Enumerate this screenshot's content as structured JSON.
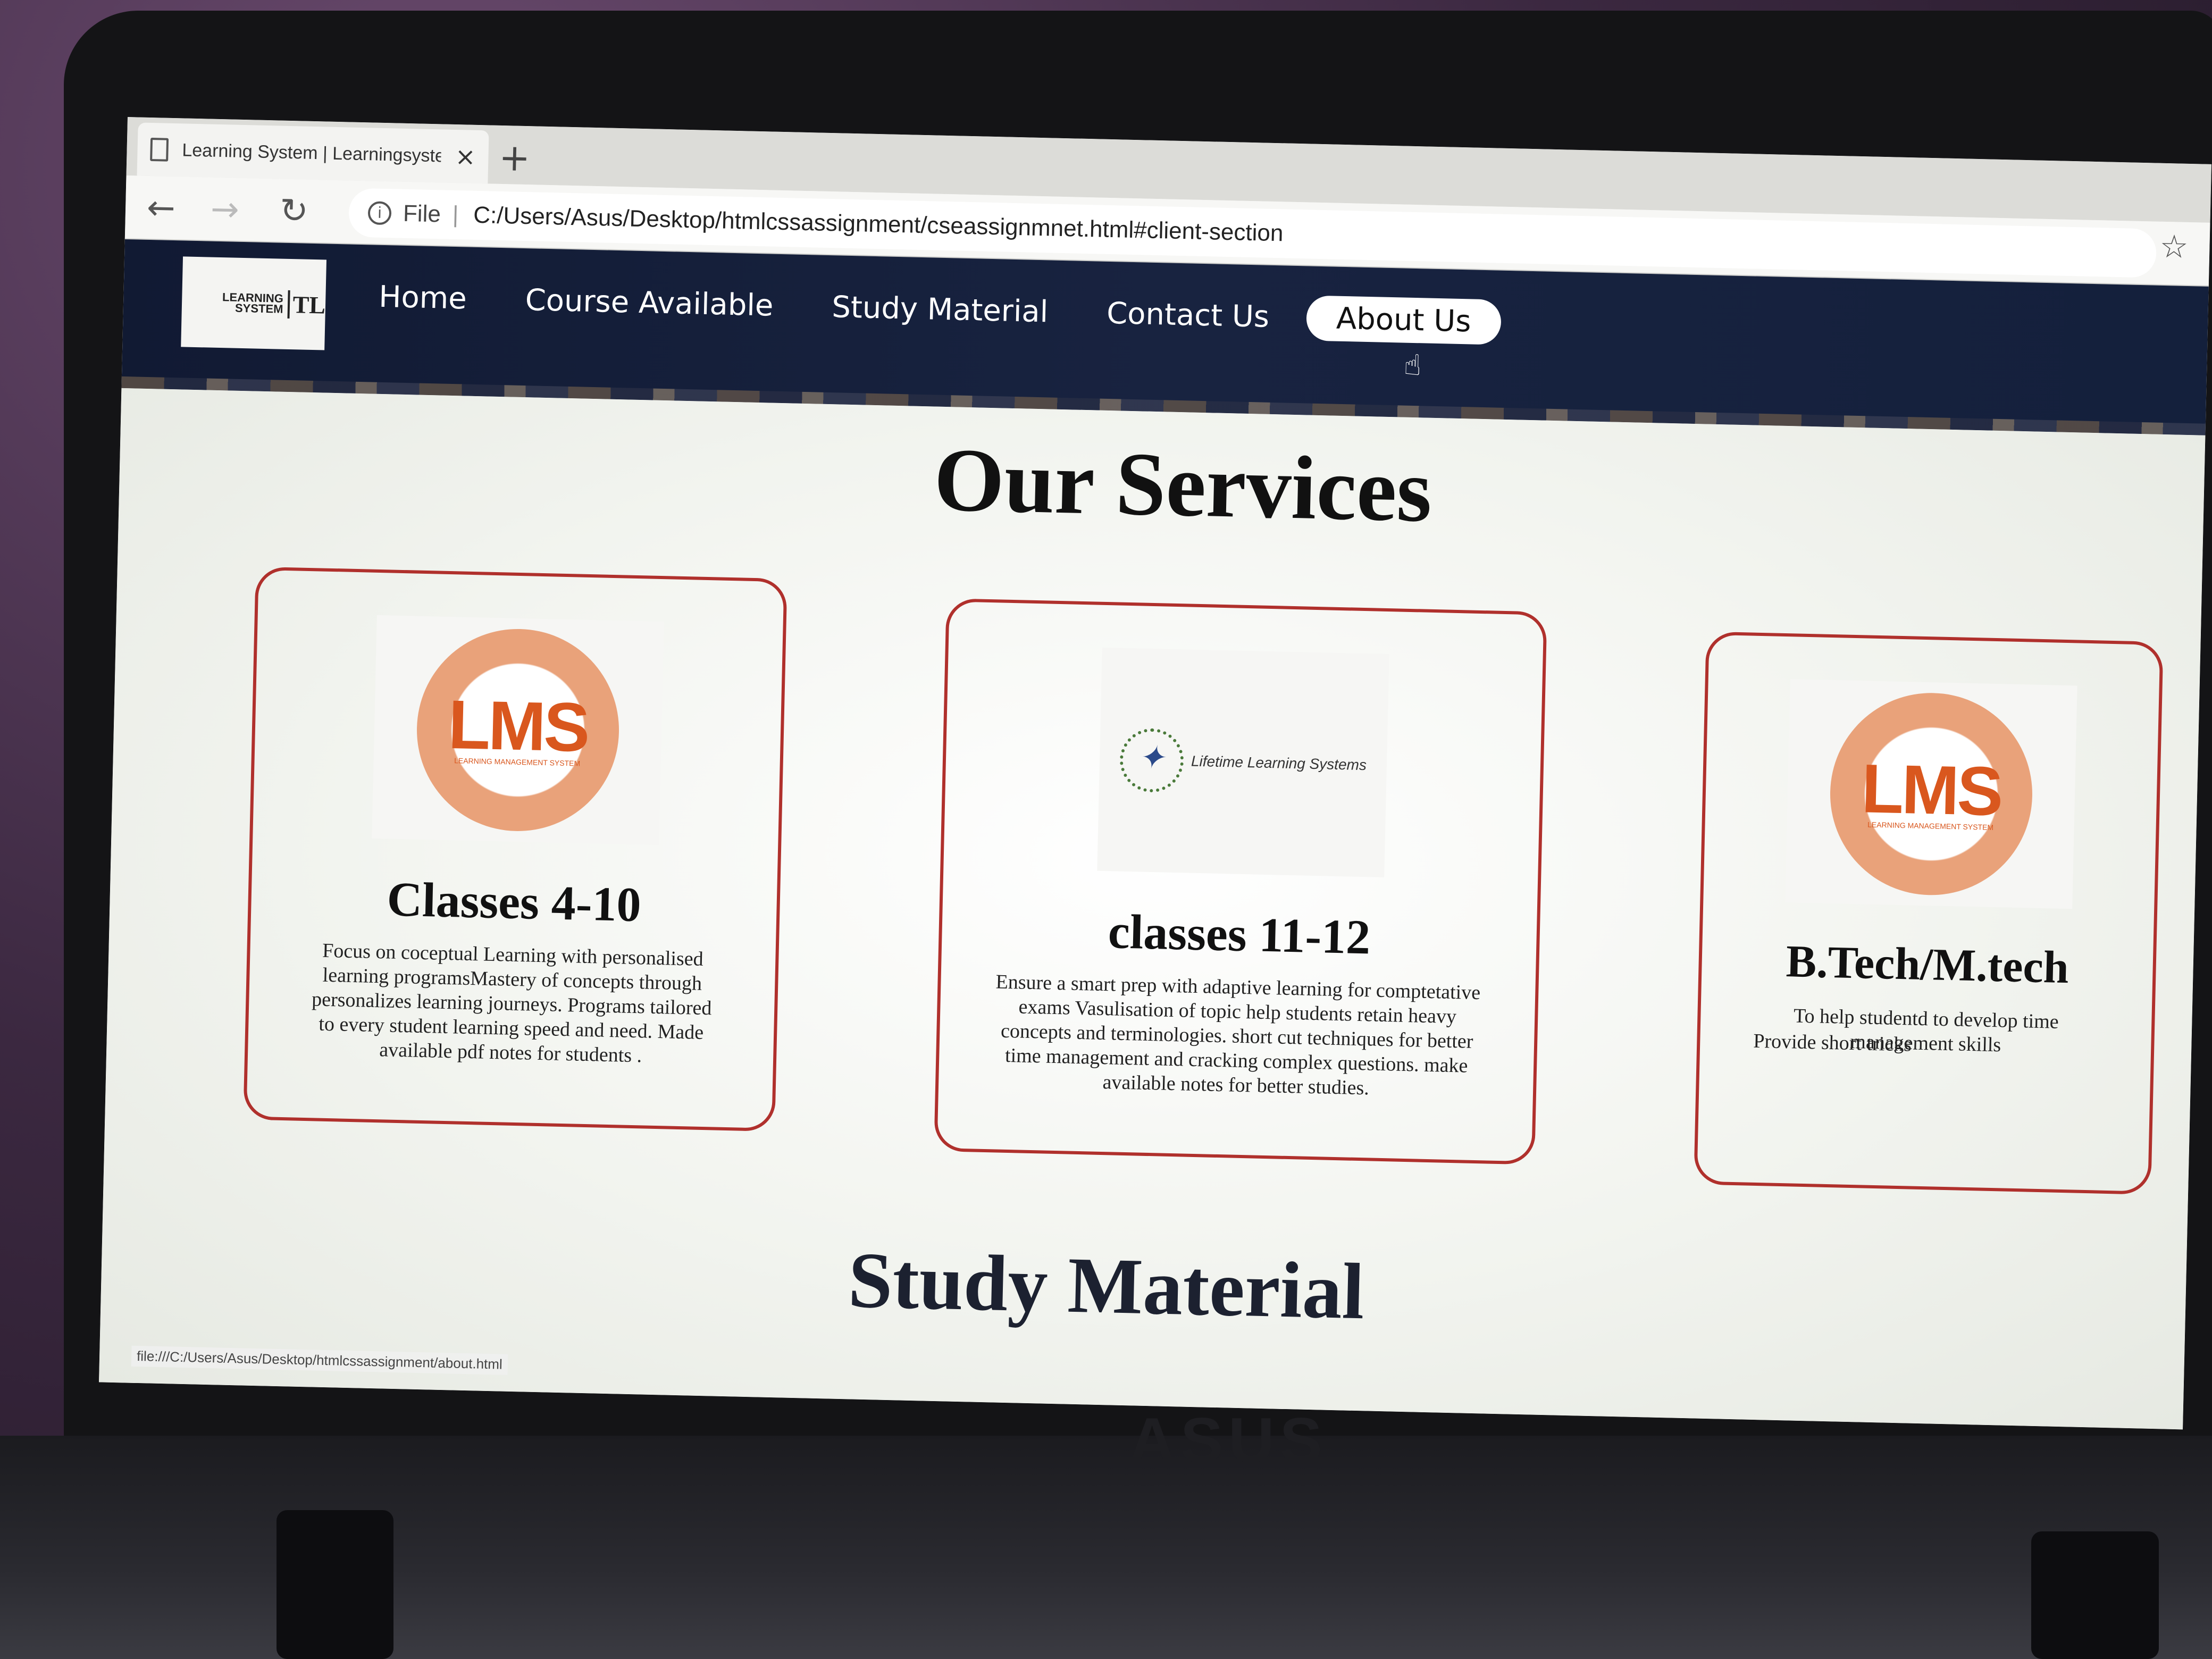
{
  "browser": {
    "tab_title": "Learning System | Learningsyste",
    "tab_close": "×",
    "new_tab": "+",
    "back": "←",
    "forward": "→",
    "reload": "↻",
    "info": "i",
    "file_label": "File",
    "separator": "|",
    "url": "C:/Users/Asus/Desktop/htmlcssassignment/cseassignmnet.html#client-section",
    "star": "☆",
    "reading": "☰",
    "status_url": "file:///C:/Users/Asus/Desktop/htmlcssassignment/about.html"
  },
  "site": {
    "logo_text": "LEARNING SYSTEM",
    "logo_mark": "TL",
    "nav": [
      {
        "label": "Home"
      },
      {
        "label": "Course Available"
      },
      {
        "label": "Study Material"
      },
      {
        "label": "Contact Us"
      },
      {
        "label": "About Us",
        "active": true
      }
    ]
  },
  "services": {
    "title": "Our Services",
    "cards": [
      {
        "image": "lms-logo",
        "badge": "LMS",
        "badge_sub": "LEARNING MANAGEMENT SYSTEM",
        "title": "Classes 4-10",
        "description": "Focus on coceptual Learning with personalised learning programsMastery of concepts through personalizes learning journeys. Programs tailored to every student learning speed and need. Made available pdf notes for students ."
      },
      {
        "image": "lifetime-learning-logo",
        "badge": "Lifetime Learning Systems",
        "title": "classes 11-12",
        "description": "Ensure a smart prep with adaptive learning for comptetative exams Vasulisation of topic help students retain heavy concepts and terminologies. short cut techniques for better time management and cracking complex questions. make available notes for better studies."
      },
      {
        "image": "lms-logo",
        "badge": "LMS",
        "badge_sub": "LEARNING MANAGEMENT SYSTEM",
        "title": "B.Tech/M.tech",
        "description": "To help studentd to develop time management skills",
        "description2": "Provide short tricks"
      }
    ]
  },
  "study": {
    "title": "Study Material"
  },
  "device": {
    "brand": "ASUS"
  }
}
